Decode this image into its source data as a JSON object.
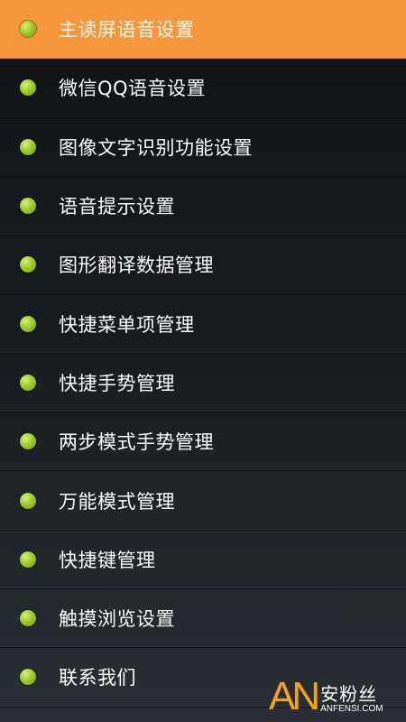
{
  "menu": {
    "items": [
      {
        "label": "主读屏语音设置",
        "active": true
      },
      {
        "label": "微信QQ语音设置",
        "active": false
      },
      {
        "label": "图像文字识别功能设置",
        "active": false
      },
      {
        "label": "语音提示设置",
        "active": false
      },
      {
        "label": "图形翻译数据管理",
        "active": false
      },
      {
        "label": "快捷菜单项管理",
        "active": false
      },
      {
        "label": "快捷手势管理",
        "active": false
      },
      {
        "label": "两步模式手势管理",
        "active": false
      },
      {
        "label": "万能模式管理",
        "active": false
      },
      {
        "label": "快捷键管理",
        "active": false
      },
      {
        "label": "触摸浏览设置",
        "active": false
      },
      {
        "label": "联系我们",
        "active": false
      }
    ]
  },
  "watermark": {
    "logo": "AN",
    "name": "安粉丝",
    "domain": "ANFENSI.COM"
  },
  "colors": {
    "active_background": "#f6963d",
    "bullet": "#9fcb2c",
    "background": "#15191d",
    "watermark_logo": "#f0a51e"
  }
}
